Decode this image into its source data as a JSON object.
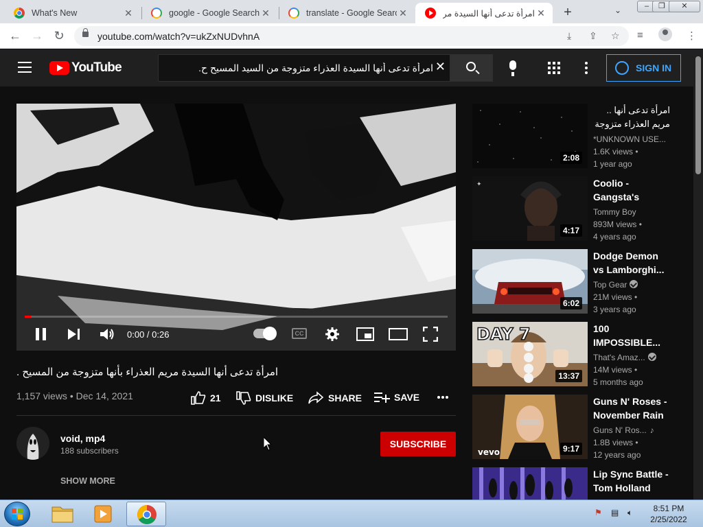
{
  "browser": {
    "tabs": [
      {
        "title": "What's New",
        "favicon": "chrome-icon",
        "active": false
      },
      {
        "title": "google - Google Search",
        "favicon": "google-icon",
        "active": false
      },
      {
        "title": "translate - Google Search",
        "favicon": "google-icon",
        "active": false
      },
      {
        "title": "امرأة تدعى أنها السيدة مريم العذ .",
        "favicon": "youtube-icon",
        "active": true
      }
    ],
    "new_tab_label": "+",
    "url": "youtube.com/watch?v=ukZxNUDvhnA"
  },
  "youtube": {
    "logo_text": "YouTube",
    "search_query": "امرأة تدعى أنها السيدة العذراء متزوجة من السيد المسيح ح.",
    "sign_in_label": "SIGN IN"
  },
  "player": {
    "current_time": "0:00",
    "duration": "0:26",
    "time_display": "0:00 / 0:26",
    "progress": 0.015,
    "buffered": 0.66,
    "cc_label": "CC"
  },
  "video": {
    "title": "امرأة تدعى أنها السيدة مريم العذراء بأنها متزوجة من المسيح .",
    "views": "1,157 views",
    "date": "Dec 14, 2021",
    "meta": "1,157 views • Dec 14, 2021",
    "likes": "21",
    "dislike_label": "DISLIKE",
    "share_label": "SHARE",
    "save_label": "SAVE"
  },
  "channel": {
    "name": "void, mp4",
    "subscribers": "188 subscribers",
    "subscribe_label": "SUBSCRIBE",
    "show_more_label": "SHOW MORE"
  },
  "recommendations": [
    {
      "title": "امرأة تدعى أنها .. مريم العذراء متزوجة",
      "channel": "*UNKNOWN USE...",
      "views": "1.6K views •",
      "age": "1 year ago",
      "duration": "2:08",
      "verified": false,
      "music": false
    },
    {
      "title": "Coolio - Gangsta's",
      "channel": "Tommy Boy",
      "views": "893M views •",
      "age": "4 years ago",
      "duration": "4:17",
      "verified": false,
      "music": false
    },
    {
      "title": "Dodge Demon vs Lamborghi...",
      "channel": "Top Gear",
      "views": "21M views •",
      "age": "3 years ago",
      "duration": "6:02",
      "verified": true,
      "music": false
    },
    {
      "title": "100 IMPOSSIBLE...",
      "channel": "That's Amaz...",
      "views": "14M views •",
      "age": "5 months ago",
      "duration": "13:37",
      "verified": true,
      "music": false
    },
    {
      "title": "Guns N' Roses - November Rain",
      "channel": "Guns N' Ros...",
      "views": "1.8B views •",
      "age": "12 years ago",
      "duration": "9:17",
      "verified": false,
      "music": true
    },
    {
      "title": "Lip Sync Battle - Tom Holland",
      "channel": "",
      "views": "",
      "age": "",
      "duration": "",
      "verified": false,
      "music": false
    }
  ],
  "thumbnail_text": {
    "day7": "DAY 7",
    "vevo": "vevo"
  },
  "taskbar": {
    "time": "8:51 PM",
    "date": "2/25/2022"
  },
  "colors": {
    "youtube_red": "#ff0000",
    "subscribe_red": "#cc0000",
    "signin_blue": "#3ea6ff",
    "dark_bg": "#0f0f0f",
    "header_bg": "#202020"
  }
}
